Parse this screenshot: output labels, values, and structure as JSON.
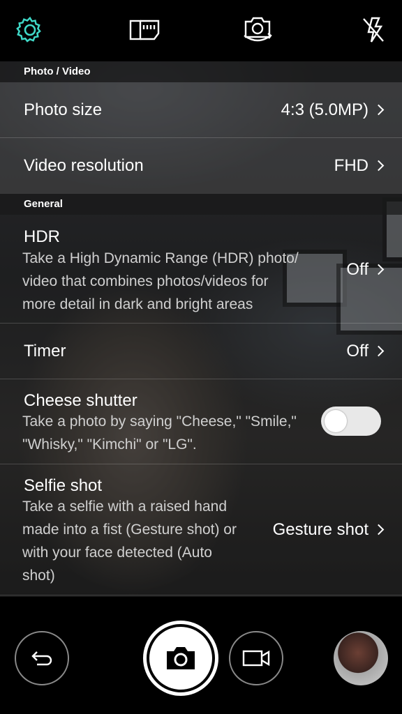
{
  "top_bar": {
    "icons": [
      "settings-gear-icon",
      "storage-sd-card-icon",
      "switch-camera-icon",
      "flash-off-icon"
    ],
    "accent_color": "#3fd9c8"
  },
  "settings": {
    "sections": [
      {
        "header": "Photo / Video",
        "rows": [
          {
            "title": "Photo size",
            "value": "4:3 (5.0MP)"
          },
          {
            "title": "Video resolution",
            "value": "FHD"
          }
        ]
      },
      {
        "header": "General",
        "rows": [
          {
            "title": "HDR",
            "desc": [
              "Take a High Dynamic Range (HDR) photo/",
              "video that combines photos/videos for",
              "more detail in dark and bright areas"
            ],
            "value": "Off"
          },
          {
            "title": "Timer",
            "value": "Off"
          },
          {
            "title": "Cheese shutter",
            "desc": [
              "Take a photo by saying \"Cheese,\" \"Smile,\"",
              "\"Whisky,\" \"Kimchi\" or \"LG\"."
            ],
            "toggle_on": false
          },
          {
            "title": "Selfie shot",
            "desc": [
              "Take a selfie with a raised hand",
              "made into a fist (Gesture shot) or",
              "with your face detected (Auto",
              "shot)"
            ],
            "value": "Gesture shot"
          }
        ]
      }
    ]
  },
  "bottom_bar": {
    "icons": [
      "back-arrow-icon",
      "camera-shutter-icon",
      "video-record-icon",
      "gallery-thumbnail"
    ]
  }
}
